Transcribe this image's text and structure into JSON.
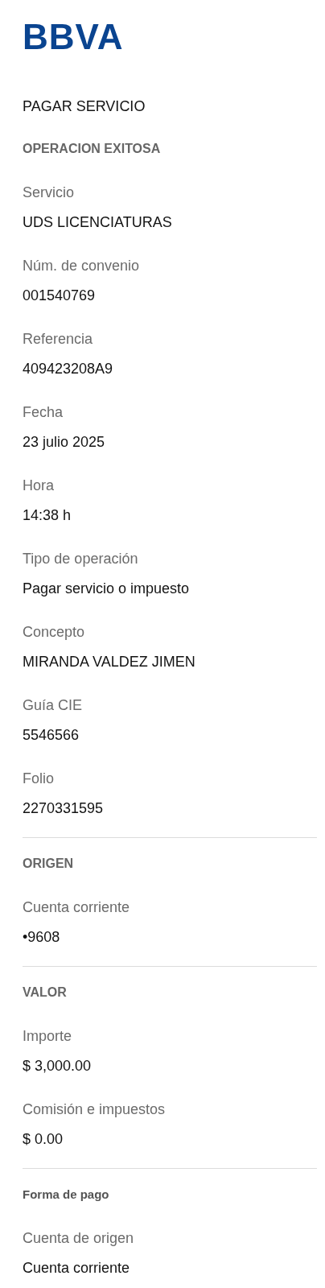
{
  "logo": "BBVA",
  "title": "PAGAR SERVICIO",
  "sections": [
    {
      "heading": "OPERACION EXITOSA",
      "kind": "caps",
      "fields": [
        {
          "label": "Servicio",
          "value": "UDS LICENCIATURAS"
        },
        {
          "label": "Núm. de convenio",
          "value": "001540769"
        },
        {
          "label": "Referencia",
          "value": "409423208A9"
        },
        {
          "label": "Fecha",
          "value": "23 julio 2025"
        },
        {
          "label": "Hora",
          "value": "14:38 h"
        },
        {
          "label": "Tipo de operación",
          "value": "Pagar servicio o impuesto"
        },
        {
          "label": "Concepto",
          "value": "MIRANDA VALDEZ JIMEN"
        },
        {
          "label": "Guía CIE",
          "value": "5546566"
        },
        {
          "label": "Folio",
          "value": "2270331595"
        }
      ]
    },
    {
      "heading": "ORIGEN",
      "kind": "caps",
      "fields": [
        {
          "label": "Cuenta corriente",
          "value": "•9608"
        }
      ]
    },
    {
      "heading": "VALOR",
      "kind": "caps",
      "fields": [
        {
          "label": "Importe",
          "value": "$ 3,000.00"
        },
        {
          "label": "Comisión e impuestos",
          "value": "$ 0.00"
        }
      ]
    },
    {
      "heading": "Forma de pago",
      "kind": "plain",
      "fields": [
        {
          "label": "Cuenta de origen",
          "value": "Cuenta corriente"
        }
      ]
    }
  ]
}
